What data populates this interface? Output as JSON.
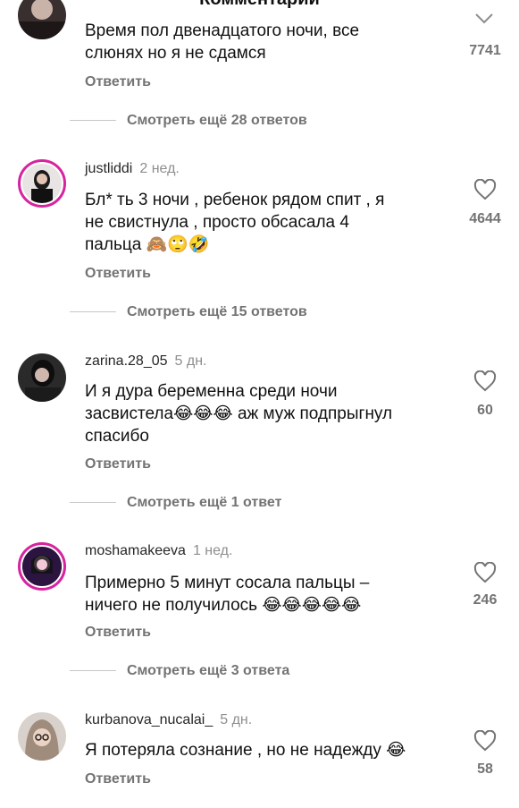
{
  "header": {
    "title": "Комментарии"
  },
  "comments": [
    {
      "text_lines": [
        "Время пол двенадцатого ночи, все",
        "слюнях но я не сдамся"
      ],
      "likes": "7741",
      "reply": "Ответить",
      "more": "Смотреть ещё 28 ответов"
    },
    {
      "username": "justliddi",
      "time": "2 нед.",
      "text_lines": [
        "Бл* ть 3 ночи , ребенок рядом спит , я",
        "не свистнула , просто обсасала 4",
        "пальца 🙈🙄🤣"
      ],
      "likes": "4644",
      "reply": "Ответить",
      "more": "Смотреть ещё 15 ответов"
    },
    {
      "username": "zarina.28_05",
      "time": "5 дн.",
      "text_lines": [
        "И я дура беременна среди ночи",
        "засвистела😂😂😂 аж муж подпрыгнул",
        "спасибо"
      ],
      "likes": "60",
      "reply": "Ответить",
      "more": "Смотреть ещё 1 ответ"
    },
    {
      "username": "moshamakeeva",
      "time": "1 нед.",
      "text_lines": [
        "Примерно 5 минут сосала пальцы –",
        "ничего не получилось 😂😂😂😂😂"
      ],
      "likes": "246",
      "reply": "Ответить",
      "more": "Смотреть ещё 3 ответа"
    },
    {
      "username": "kurbanova_nucalai_",
      "time": "5 дн.",
      "text_lines": [
        "Я потеряла сознание , но не надежду 😂"
      ],
      "likes": "58",
      "reply": "Ответить"
    }
  ],
  "icons": {
    "like": "heart-outline-icon",
    "collapse": "chevron-down-icon"
  }
}
